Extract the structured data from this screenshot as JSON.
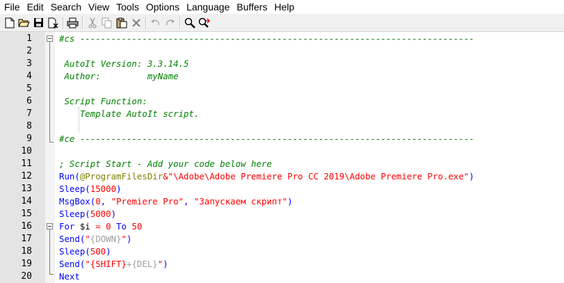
{
  "menu": [
    "File",
    "Edit",
    "Search",
    "View",
    "Tools",
    "Options",
    "Language",
    "Buffers",
    "Help"
  ],
  "toolbar_icons": [
    "new-file-icon",
    "open-folder-icon",
    "save-icon",
    "close-file-icon",
    "print-icon",
    "cut-icon",
    "copy-icon",
    "paste-icon",
    "delete-icon",
    "undo-icon",
    "redo-icon",
    "find-icon",
    "replace-icon"
  ],
  "editor": {
    "lines": [
      {
        "n": "1",
        "segs": [
          {
            "c": "c-com",
            "t": "#cs ----------------------------------------------------------------------------"
          }
        ]
      },
      {
        "n": "2",
        "segs": []
      },
      {
        "n": "3",
        "segs": [
          {
            "c": "c-com",
            "t": " AutoIt Version: 3.3.14.5"
          }
        ]
      },
      {
        "n": "4",
        "segs": [
          {
            "c": "c-com",
            "t": " Author:         myName"
          }
        ]
      },
      {
        "n": "5",
        "segs": []
      },
      {
        "n": "6",
        "segs": [
          {
            "c": "c-com",
            "t": " Script Function:"
          }
        ]
      },
      {
        "n": "7",
        "segs": [
          {
            "c": "c-com",
            "t": "    Template AutoIt script."
          }
        ]
      },
      {
        "n": "8",
        "segs": []
      },
      {
        "n": "9",
        "segs": [
          {
            "c": "c-com",
            "t": "#ce ----------------------------------------------------------------------------"
          }
        ]
      },
      {
        "n": "10",
        "segs": []
      },
      {
        "n": "11",
        "segs": [
          {
            "c": "c-com",
            "t": "; Script Start - Add your code below here"
          }
        ]
      },
      {
        "n": "12",
        "segs": [
          {
            "c": "c-kw",
            "t": "Run("
          },
          {
            "c": "c-macro",
            "t": "@ProgramFilesDir"
          },
          {
            "c": "c-op",
            "t": "&"
          },
          {
            "c": "c-str",
            "t": "\"\\Adobe\\Adobe Premiere Pro CC 2019\\Adobe Premiere Pro.exe\""
          },
          {
            "c": "c-kw",
            "t": ")"
          }
        ]
      },
      {
        "n": "13",
        "segs": [
          {
            "c": "c-kw",
            "t": "Sleep("
          },
          {
            "c": "c-num",
            "t": "15000"
          },
          {
            "c": "c-kw",
            "t": ")"
          }
        ]
      },
      {
        "n": "14",
        "segs": [
          {
            "c": "c-kw",
            "t": "MsgBox("
          },
          {
            "c": "c-num",
            "t": "0"
          },
          {
            "c": "c-kw",
            "t": ", "
          },
          {
            "c": "c-str",
            "t": "\"Premiere Pro\""
          },
          {
            "c": "c-kw",
            "t": ", "
          },
          {
            "c": "c-str",
            "t": "\"Запускаем скрипт\""
          },
          {
            "c": "c-kw",
            "t": ")"
          }
        ]
      },
      {
        "n": "15",
        "segs": [
          {
            "c": "c-kw",
            "t": "Sleep("
          },
          {
            "c": "c-num",
            "t": "5000"
          },
          {
            "c": "c-kw",
            "t": ")"
          }
        ]
      },
      {
        "n": "16",
        "segs": [
          {
            "c": "c-kw",
            "t": "For "
          },
          {
            "c": "c-var",
            "t": "$i"
          },
          {
            "c": "c-kw",
            "t": " "
          },
          {
            "c": "c-op",
            "t": "="
          },
          {
            "c": "c-kw",
            "t": " "
          },
          {
            "c": "c-num",
            "t": "0"
          },
          {
            "c": "c-kw",
            "t": " To "
          },
          {
            "c": "c-num",
            "t": "50"
          }
        ]
      },
      {
        "n": "17",
        "segs": [
          {
            "c": "c-kw",
            "t": "Send("
          },
          {
            "c": "c-str",
            "t": "\""
          },
          {
            "c": "c-send",
            "t": "{DOWN}"
          },
          {
            "c": "c-str",
            "t": "\""
          },
          {
            "c": "c-kw",
            "t": ")"
          }
        ]
      },
      {
        "n": "18",
        "segs": [
          {
            "c": "c-kw",
            "t": "Sleep("
          },
          {
            "c": "c-num",
            "t": "500"
          },
          {
            "c": "c-kw",
            "t": ")"
          }
        ]
      },
      {
        "n": "19",
        "segs": [
          {
            "c": "c-kw",
            "t": "Send("
          },
          {
            "c": "c-str",
            "t": "\"{SHIFT}"
          },
          {
            "c": "c-send",
            "t": "+{DEL}"
          },
          {
            "c": "c-str",
            "t": "\""
          },
          {
            "c": "c-kw",
            "t": ")"
          }
        ]
      },
      {
        "n": "20",
        "segs": [
          {
            "c": "c-kw",
            "t": "Next"
          }
        ]
      }
    ]
  }
}
